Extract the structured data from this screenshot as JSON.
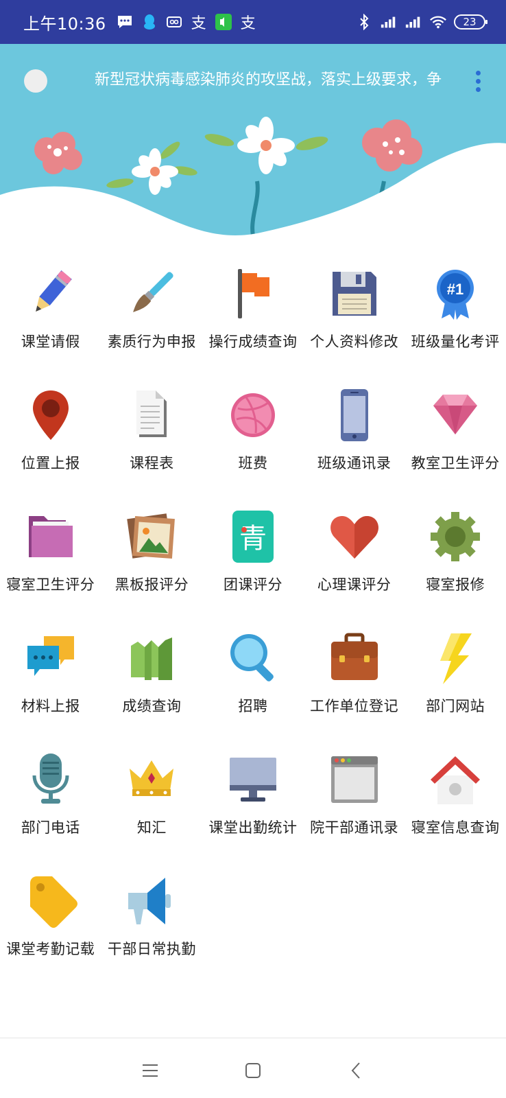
{
  "status": {
    "time": "上午10:36",
    "battery": "23",
    "left_icons": [
      "message-icon",
      "qq-icon",
      "sim-icon",
      "alipay-icon",
      "wechat-call-icon",
      "alipay-icon"
    ],
    "right_icons": [
      "bluetooth-icon",
      "signal-icon",
      "signal-icon",
      "wifi-icon",
      "battery-icon"
    ]
  },
  "header": {
    "marquee_text": "新型冠状病毒感染肺炎的攻坚战，落实上级要求，争",
    "colors": {
      "banner": "#6cc7dd",
      "status_bar": "#2f3d9e"
    }
  },
  "grid": {
    "items": [
      {
        "label": "课堂请假",
        "icon": "pencil-icon"
      },
      {
        "label": "素质行为申报",
        "icon": "paintbrush-icon"
      },
      {
        "label": "操行成绩查询",
        "icon": "flag-icon"
      },
      {
        "label": "个人资料修改",
        "icon": "floppy-disk-icon"
      },
      {
        "label": "班级量化考评",
        "icon": "rank-badge-icon"
      },
      {
        "label": "位置上报",
        "icon": "map-pin-icon"
      },
      {
        "label": "课程表",
        "icon": "document-icon"
      },
      {
        "label": "班费",
        "icon": "dribbble-ball-icon"
      },
      {
        "label": "班级通讯录",
        "icon": "smartphone-icon"
      },
      {
        "label": "教室卫生评分",
        "icon": "diamond-icon"
      },
      {
        "label": "寝室卫生评分",
        "icon": "folder-icon"
      },
      {
        "label": "黑板报评分",
        "icon": "picture-icon"
      },
      {
        "label": "团课评分",
        "icon": "youth-league-icon"
      },
      {
        "label": "心理课评分",
        "icon": "heart-icon"
      },
      {
        "label": "寝室报修",
        "icon": "gear-icon"
      },
      {
        "label": "材料上报",
        "icon": "chat-bubbles-icon"
      },
      {
        "label": "成绩查询",
        "icon": "chart-map-icon"
      },
      {
        "label": "招聘",
        "icon": "magnifier-icon"
      },
      {
        "label": "工作单位登记",
        "icon": "briefcase-icon"
      },
      {
        "label": "部门网站",
        "icon": "lightning-icon"
      },
      {
        "label": "部门电话",
        "icon": "microphone-icon"
      },
      {
        "label": "知汇",
        "icon": "crown-icon"
      },
      {
        "label": "课堂出勤统计",
        "icon": "monitor-icon"
      },
      {
        "label": "院干部通讯录",
        "icon": "browser-window-icon"
      },
      {
        "label": "寝室信息查询",
        "icon": "house-icon"
      },
      {
        "label": "课堂考勤记载",
        "icon": "tag-icon"
      },
      {
        "label": "干部日常执勤",
        "icon": "megaphone-icon"
      }
    ]
  },
  "nav": {
    "buttons": [
      "menu-icon",
      "home-icon",
      "back-icon"
    ]
  }
}
